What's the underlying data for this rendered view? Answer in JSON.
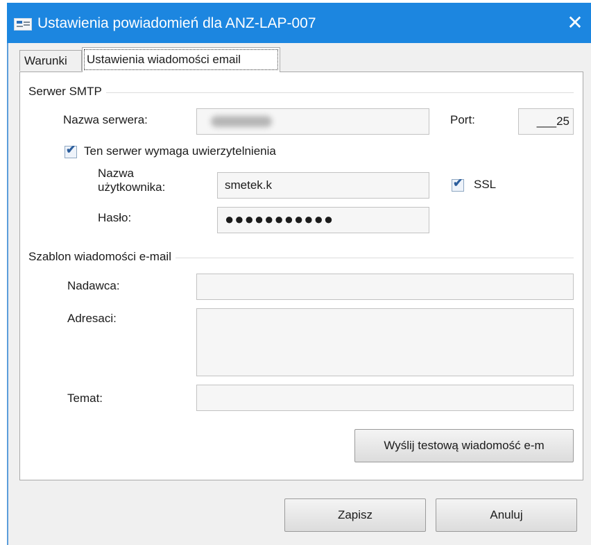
{
  "window": {
    "title": "Ustawienia powiadomień dla ANZ-LAP-007",
    "close_symbol": "✕"
  },
  "tabs": [
    {
      "label": "Warunki",
      "active": false
    },
    {
      "label": "Ustawienia wiadomości email",
      "active": true
    }
  ],
  "smtp": {
    "group_title": "Serwer SMTP",
    "server_label": "Nazwa serwera:",
    "server_value": "",
    "port_label": "Port:",
    "port_value": "___25",
    "auth_label": "Ten serwer wymaga uwierzytelnienia",
    "auth_checked": true,
    "username_label": "Nazwa użytkownika:",
    "username_value": "smetek.k",
    "ssl_label": "SSL",
    "ssl_checked": true,
    "password_label": "Hasło:",
    "password_value": "●●●●●●●●●●●"
  },
  "template": {
    "group_title": "Szablon wiadomości e-mail",
    "sender_label": "Nadawca:",
    "sender_value": "",
    "recipients_label": "Adresaci:",
    "recipients_value": "",
    "subject_label": "Temat:",
    "subject_value": "",
    "test_button": "Wyślij testową wiadomość e-m"
  },
  "footer": {
    "save_button": "Zapisz",
    "cancel_button": "Anuluj"
  },
  "colors": {
    "titlebar": "#1c86e0",
    "background": "#f0f0f0",
    "panel": "#ffffff"
  }
}
